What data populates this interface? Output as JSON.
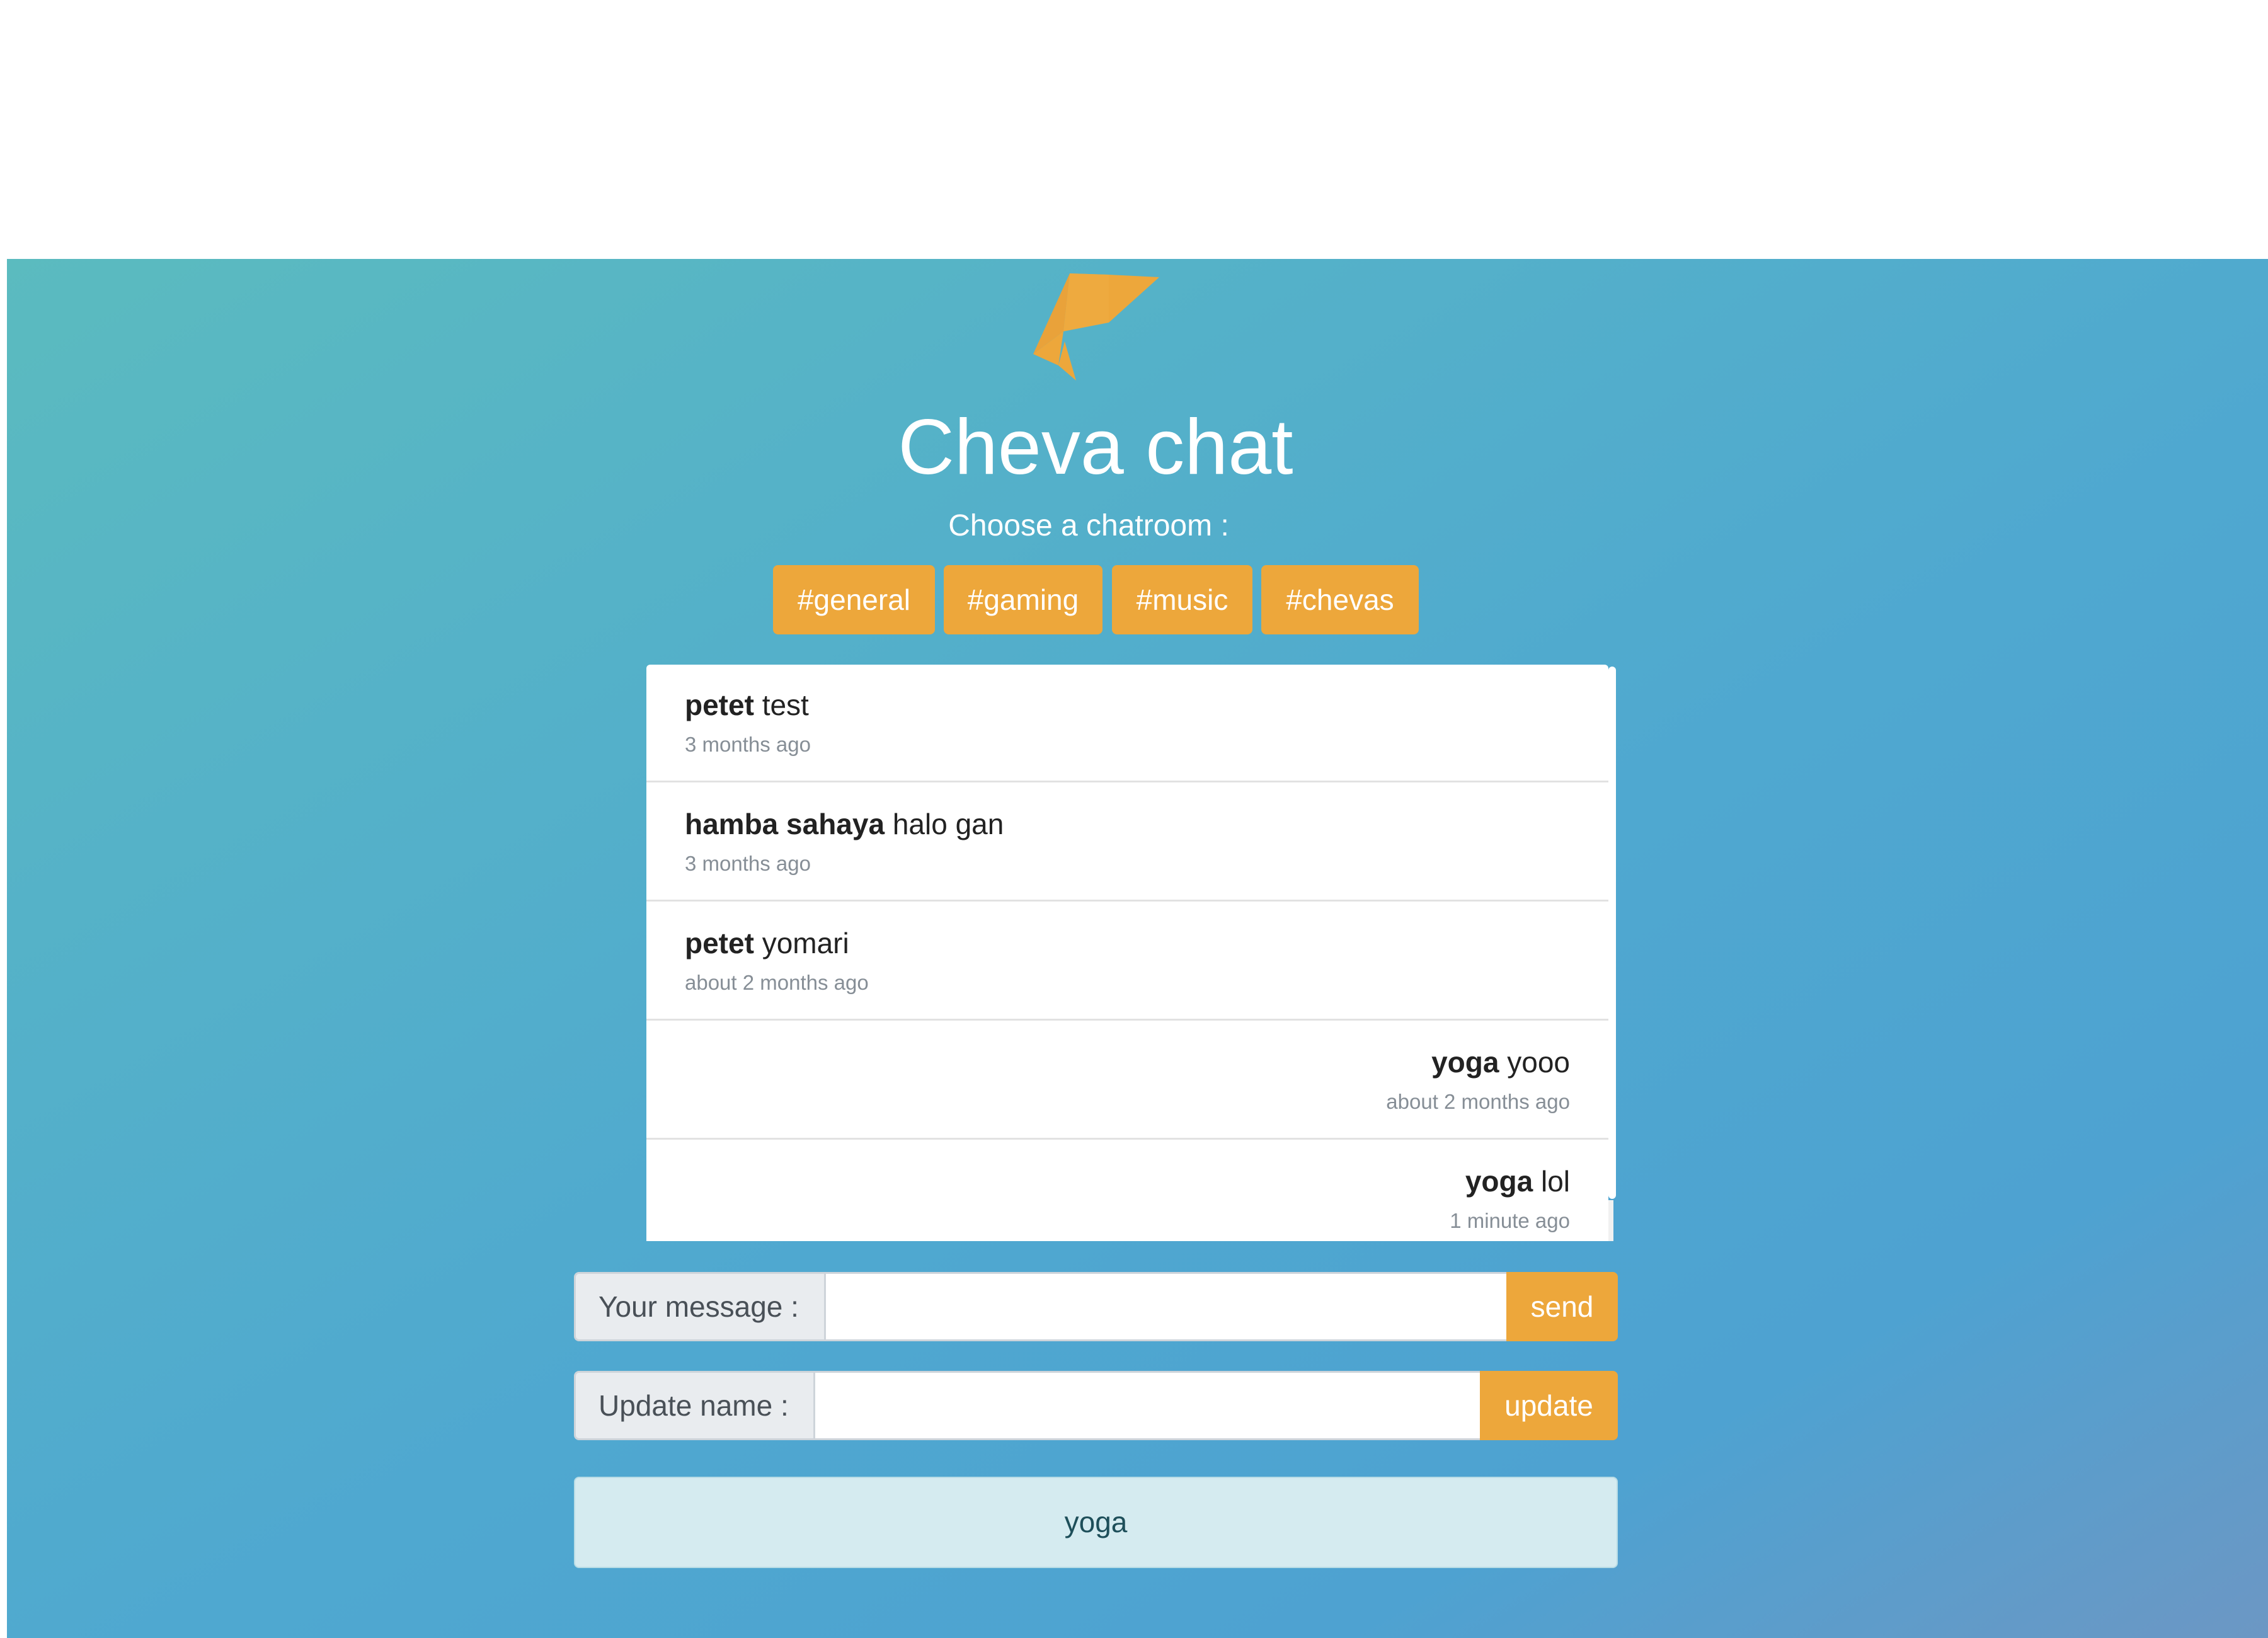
{
  "app": {
    "title": "Cheva chat",
    "subtitle": "Choose a chatroom :"
  },
  "rooms": [
    "#general",
    "#gaming",
    "#music",
    "#chevas"
  ],
  "messages": [
    {
      "user": "petet",
      "text": "test",
      "time": "3 months ago",
      "align": "left"
    },
    {
      "user": "hamba sahaya",
      "text": "halo gan",
      "time": "3 months ago",
      "align": "left"
    },
    {
      "user": "petet",
      "text": "yomari",
      "time": "about 2 months ago",
      "align": "left"
    },
    {
      "user": "yoga",
      "text": "yooo",
      "time": "about 2 months ago",
      "align": "right"
    },
    {
      "user": "yoga",
      "text": "lol",
      "time": "1 minute ago",
      "align": "right"
    }
  ],
  "message_form": {
    "label": "Your message :",
    "value": "",
    "button": "send"
  },
  "name_form": {
    "label": "Update name :",
    "value": "",
    "button": "update"
  },
  "current_user": "yoga",
  "colors": {
    "accent": "#eda73b",
    "hero_gradient_start": "#5bbbbf",
    "hero_gradient_end": "#4ea2d1",
    "name_box": "#d5ebf0"
  },
  "icons": {
    "logo": "origami-bird-icon"
  }
}
